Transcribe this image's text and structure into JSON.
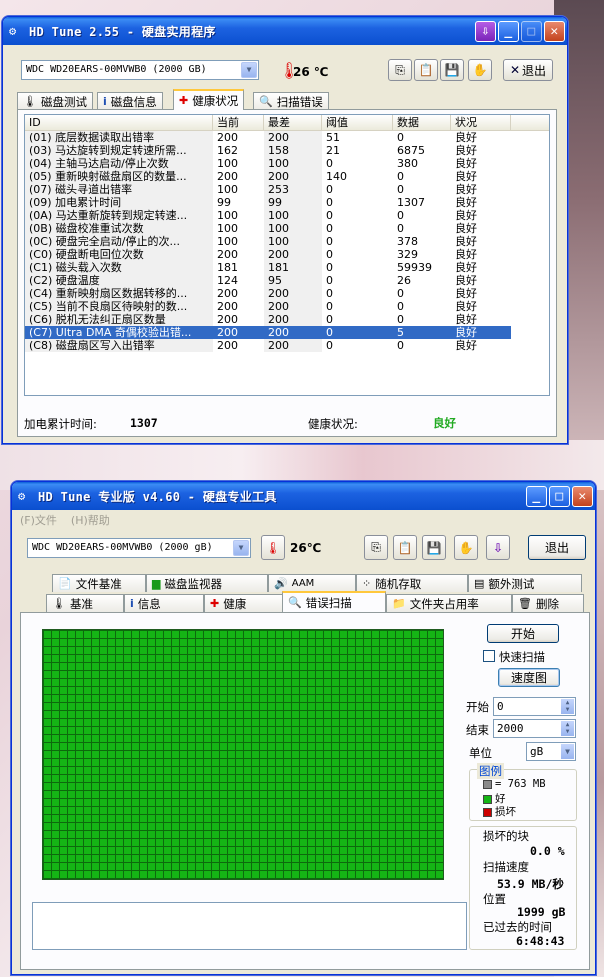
{
  "win1": {
    "title": "HD Tune 2.55 - 硬盘实用程序",
    "drive": "WDC WD20EARS-00MVWB0 (2000 GB)",
    "temp": "26 ℃",
    "exit_label": "退出",
    "tabs": [
      "磁盘测试",
      "磁盘信息",
      "健康状况",
      "扫描错误"
    ],
    "columns": [
      "ID",
      "当前",
      "最差",
      "阈值",
      "数据",
      "状况"
    ],
    "rows": [
      [
        "(01) 底层数据读取出错率",
        "200",
        "200",
        "51",
        "0",
        "良好"
      ],
      [
        "(03) 马达旋转到规定转速所需...",
        "162",
        "158",
        "21",
        "6875",
        "良好"
      ],
      [
        "(04) 主轴马达启动/停止次数",
        "100",
        "100",
        "0",
        "380",
        "良好"
      ],
      [
        "(05) 重新映射磁盘扇区的数量...",
        "200",
        "200",
        "140",
        "0",
        "良好"
      ],
      [
        "(07) 磁头寻道出错率",
        "100",
        "253",
        "0",
        "0",
        "良好"
      ],
      [
        "(09) 加电累计时间",
        "99",
        "99",
        "0",
        "1307",
        "良好"
      ],
      [
        "(0A) 马达重新旋转到规定转速...",
        "100",
        "100",
        "0",
        "0",
        "良好"
      ],
      [
        "(0B) 磁盘校准重试次数",
        "100",
        "100",
        "0",
        "0",
        "良好"
      ],
      [
        "(0C) 硬盘完全启动/停止的次...",
        "100",
        "100",
        "0",
        "378",
        "良好"
      ],
      [
        "(C0) 硬盘断电回位次数",
        "200",
        "200",
        "0",
        "329",
        "良好"
      ],
      [
        "(C1) 磁头载入次数",
        "181",
        "181",
        "0",
        "59939",
        "良好"
      ],
      [
        "(C2) 硬盘温度",
        "124",
        "95",
        "0",
        "26",
        "良好"
      ],
      [
        "(C4) 重新映射扇区数据转移的...",
        "200",
        "200",
        "0",
        "0",
        "良好"
      ],
      [
        "(C5) 当前不良扇区待映射的数...",
        "200",
        "200",
        "0",
        "0",
        "良好"
      ],
      [
        "(C6) 脱机无法纠正扇区数量",
        "200",
        "200",
        "0",
        "0",
        "良好"
      ],
      [
        "(C7) Ultra DMA 奇偶校验出错...",
        "200",
        "200",
        "0",
        "5",
        "良好"
      ],
      [
        "(C8) 磁盘扇区写入出错率",
        "200",
        "200",
        "0",
        "0",
        "良好"
      ]
    ],
    "selected_row": 15,
    "power_on_label": "加电累计时间:",
    "power_on_value": "1307",
    "health_label": "健康状况:",
    "health_value": "良好"
  },
  "win2": {
    "title": "HD Tune 专业版 v4.60 - 硬盘专业工具",
    "menu": [
      "(F)文件",
      "(H)帮助"
    ],
    "drive": "WDC WD20EARS-00MVWB0 (2000 gB)",
    "temp": "26℃",
    "exit_label": "退出",
    "tabs_row1": [
      "文件基准",
      "磁盘监视器",
      "AAM",
      "随机存取",
      "额外测试"
    ],
    "tabs_row2": [
      "基准",
      "信息",
      "健康",
      "错误扫描",
      "文件夹占用率",
      "删除"
    ],
    "start_btn": "开始",
    "quick_scan": "快速扫描",
    "speed_map": "速度图",
    "start_label": "开始",
    "start_value": "0",
    "end_label": "结束",
    "end_value": "2000",
    "unit_label": "单位",
    "unit_value": "gB",
    "legend_title": "图例",
    "legend_block": "= 763 MB",
    "legend_good": "好",
    "legend_bad": "损坏",
    "damaged_label": "损坏的块",
    "damaged_value": "0.0 %",
    "scan_speed_label": "扫描速度",
    "scan_speed_value": "53.9 MB/秒",
    "position_label": "位置",
    "position_value": "1999 gB",
    "elapsed_label": "已过去的时间",
    "elapsed_value": "6:48:43"
  },
  "colors": {
    "good": "#15b515",
    "bad": "#cc0000",
    "selection": "#316ac5",
    "health_good": "#22aa22"
  }
}
